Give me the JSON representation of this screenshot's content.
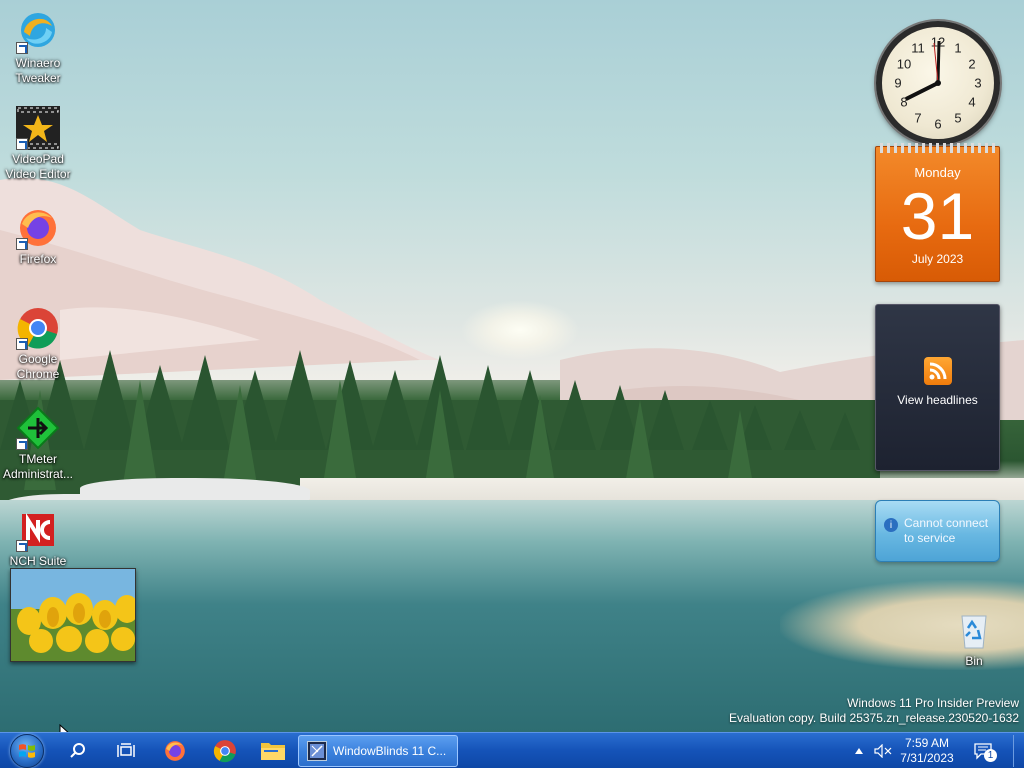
{
  "desktop_icons": [
    {
      "label": "Winaero Tweaker",
      "icon": "winaero-icon"
    },
    {
      "label": "VideoPad Video Editor",
      "icon": "videopad-icon"
    },
    {
      "label": "Firefox",
      "icon": "firefox-icon"
    },
    {
      "label": "Google Chrome",
      "icon": "chrome-icon"
    },
    {
      "label": "TMeter Administrat...",
      "icon": "tmeter-icon"
    },
    {
      "label": "NCH Suite",
      "icon": "nch-icon"
    },
    {
      "label": "Bin",
      "icon": "recycle-bin-icon"
    }
  ],
  "clock_gadget": {
    "numbers": [
      "12",
      "1",
      "2",
      "3",
      "4",
      "5",
      "6",
      "7",
      "8",
      "9",
      "10",
      "11"
    ]
  },
  "calendar_gadget": {
    "weekday": "Monday",
    "day": "31",
    "month_year": "July 2023"
  },
  "feed_gadget": {
    "label": "View headlines"
  },
  "weather_gadget": {
    "message": "Cannot connect to service"
  },
  "watermark": {
    "line1": "Windows 11 Pro Insider Preview",
    "line2": "Evaluation copy. Build 25375.zn_release.230520-1632"
  },
  "taskbar": {
    "window_label": "WindowBlinds 11 C...",
    "time": "7:59 AM",
    "date": "7/31/2023",
    "notification_count": "1"
  },
  "colors": {
    "taskbar": "#1553b8",
    "calendar": "#e76a10",
    "accent": "#2a6ed0"
  }
}
